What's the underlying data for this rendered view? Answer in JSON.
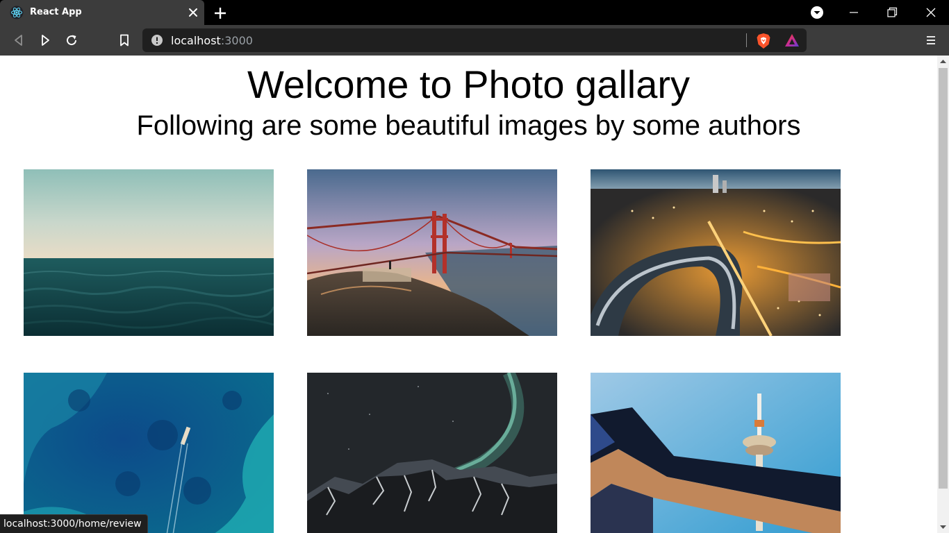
{
  "browser": {
    "tab_title": "React App",
    "url_host": "localhost",
    "url_port": ":3000",
    "status_url": "localhost:3000/home/review"
  },
  "page": {
    "title": "Welcome to Photo gallary",
    "subtitle": "Following are some beautiful images by some authors"
  },
  "gallery": {
    "images": [
      {
        "subject": "ocean-horizon"
      },
      {
        "subject": "golden-gate-bridge"
      },
      {
        "subject": "city-at-night"
      },
      {
        "subject": "aerial-reef-boat"
      },
      {
        "subject": "aurora-mountains"
      },
      {
        "subject": "tv-tower"
      }
    ]
  },
  "colors": {
    "chrome_dark": "#000000",
    "toolbar": "#3c3c3c",
    "omnibox": "#1f1f1f",
    "brave_orange": "#fb542b"
  }
}
